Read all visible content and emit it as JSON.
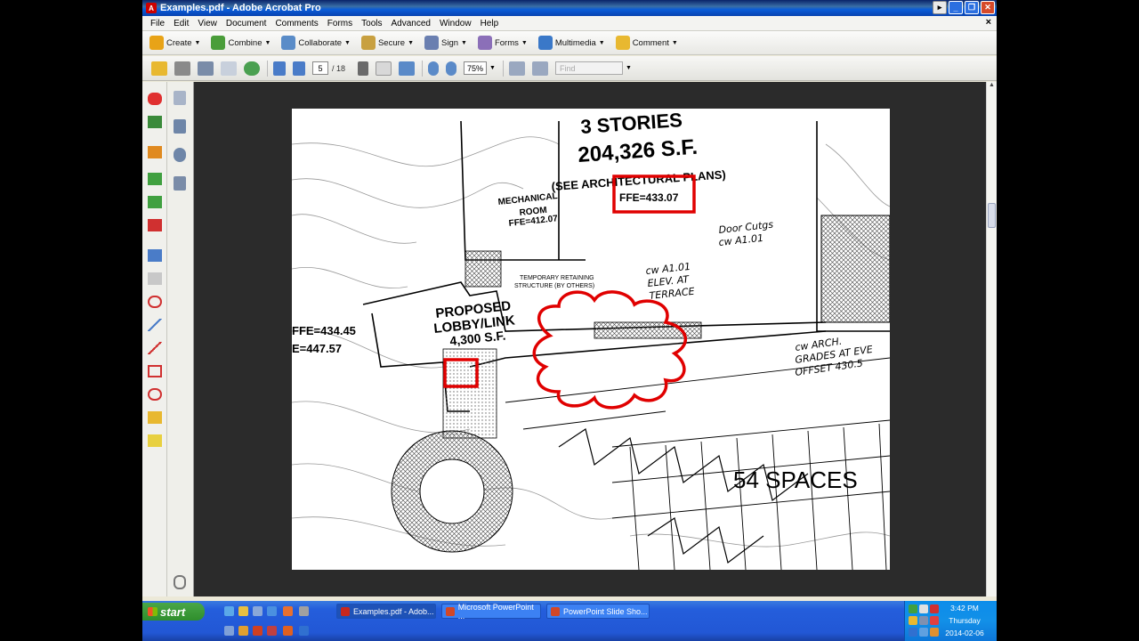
{
  "window": {
    "title": "Examples.pdf - Adobe Acrobat Pro",
    "app_icon": "acrobat-icon",
    "buttons": [
      "arrow",
      "minimize",
      "maximize",
      "close"
    ]
  },
  "menu": {
    "items": [
      "File",
      "Edit",
      "View",
      "Document",
      "Comments",
      "Forms",
      "Tools",
      "Advanced",
      "Window",
      "Help"
    ],
    "close_doc": "×"
  },
  "tasks": [
    {
      "label": "Create",
      "icon": "create-icon",
      "color": "#E8A317"
    },
    {
      "label": "Combine",
      "icon": "combine-icon",
      "color": "#4A9D3A"
    },
    {
      "label": "Collaborate",
      "icon": "collaborate-icon",
      "color": "#5A8CC8"
    },
    {
      "label": "Secure",
      "icon": "lock-icon",
      "color": "#C8A040"
    },
    {
      "label": "Sign",
      "icon": "pen-icon",
      "color": "#6A7FB0"
    },
    {
      "label": "Forms",
      "icon": "forms-icon",
      "color": "#8B6FB8"
    },
    {
      "label": "Multimedia",
      "icon": "multimedia-icon",
      "color": "#3A78C8"
    },
    {
      "label": "Comment",
      "icon": "comment-icon",
      "color": "#E8B830"
    }
  ],
  "toolbar": {
    "current_page": "5",
    "total_pages": "/ 18",
    "zoom": "75%",
    "find_placeholder": "Find"
  },
  "drawing": {
    "labels": {
      "stories": "3 STORIES",
      "area_main": "204,326 S.F.",
      "see_plans": "(SEE ARCHITECTURAL PLANS)",
      "ffe_main": "FFE=433.07",
      "mech_room_1": "MECHANICAL",
      "mech_room_2": "ROOM",
      "mech_ffe": "FFE=412.07",
      "temp_wall_1": "TEMPORARY RETAINING",
      "temp_wall_2": "STRUCTURE (BY OTHERS)",
      "proposed": "PROPOSED",
      "lobby": "LOBBY/LINK",
      "lobby_area": "4,300 S.F.",
      "ffe_left_1": "FFE=434.45",
      "ffe_left_2": "E=447.57",
      "spaces": "54 SPACES",
      "note_door": "Door Cutgs",
      "note_door_2": "cw A1.01",
      "note_elev_1": "cw A1.01",
      "note_elev_2": "ELEV. AT",
      "note_elev_3": "TERRACE",
      "note_grade_1": "cw ARCH.",
      "note_grade_2": "GRADES AT EVE",
      "note_grade_3": "OFFSET 430.5"
    },
    "markup_color": "#E00000"
  },
  "taskbar": {
    "start": "start",
    "tasks": [
      {
        "label": "Examples.pdf - Adob...",
        "icon": "acrobat-icon",
        "color": "#C8281E",
        "active": true
      },
      {
        "label": "Microsoft PowerPoint ...",
        "icon": "powerpoint-icon",
        "color": "#D24726",
        "active": false
      },
      {
        "label": "PowerPoint Slide Sho...",
        "icon": "slideshow-icon",
        "color": "#D24726",
        "active": false
      }
    ],
    "clock_time": "3:42 PM",
    "clock_day": "Thursday",
    "clock_date": "2014-02-06"
  }
}
